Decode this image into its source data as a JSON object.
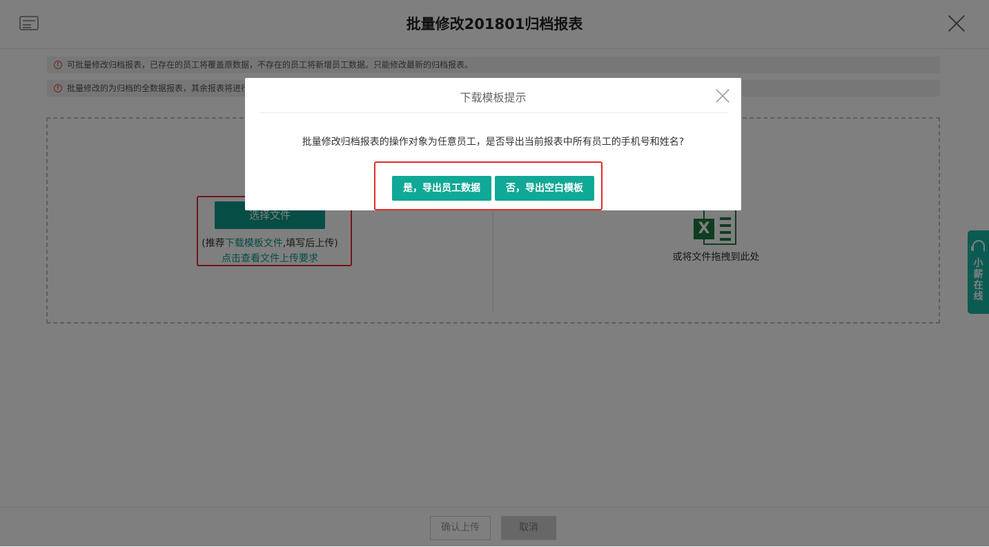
{
  "header": {
    "title": "批量修改201801归档报表",
    "icon": "document-icon",
    "close_icon": "close-icon"
  },
  "notices": [
    {
      "text": "可批量修改归档报表，已存在的员工将覆盖原数据，不存在的员工将新增员工数据。只能修改最新的归档报表。"
    },
    {
      "text": "批量修改的为归档的全数据报表，其余报表将进行"
    }
  ],
  "upload": {
    "select_button": "选择文件",
    "hint_prefix": "(推荐",
    "hint_link": "下载模板文件",
    "hint_suffix": ",填写后上传)",
    "requirements_link": "点击查看文件上传要求",
    "drag_text": "或将文件拖拽到此处"
  },
  "side_widget": {
    "label": "小薪在线"
  },
  "footer": {
    "confirm_label": "确认上传",
    "cancel_label": "取消"
  },
  "modal": {
    "title": "下载模板提示",
    "message": "批量修改归档报表的操作对象为任意员工，是否导出当前报表中所有员工的手机号和姓名?",
    "yes_label": "是，导出员工数据",
    "no_label": "否，导出空白模板"
  },
  "colors": {
    "accent": "#10a896",
    "highlight_box": "#e52a2a",
    "warning": "#e0443b"
  }
}
